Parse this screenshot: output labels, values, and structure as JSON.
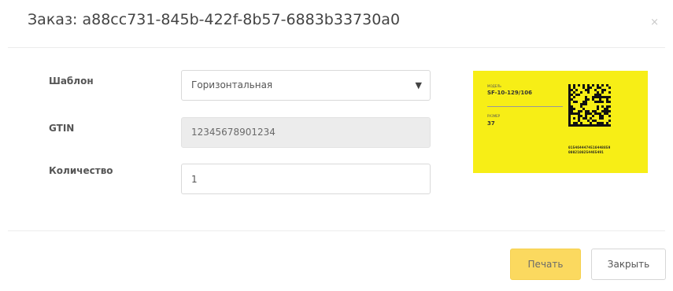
{
  "modal": {
    "title": "Заказ: a88cc731-845b-422f-8b57-6883b33730a0",
    "close_icon": "×"
  },
  "form": {
    "template": {
      "label": "Шаблон",
      "selected": "Горизонтальная",
      "arrow_icon": "▼"
    },
    "gtin": {
      "label": "GTIN",
      "value": "12345678901234"
    },
    "quantity": {
      "label": "Количество",
      "value": "1"
    }
  },
  "preview": {
    "background": "#f7ee16",
    "model_caption": "МОДЕЛЬ",
    "model": "SF-10-129/106",
    "size_caption": "РАЗМЕР",
    "size": "37",
    "code_line1": "0154644474516448859",
    "code_line2": "0002100254465491"
  },
  "footer": {
    "print_label": "Печать",
    "close_label": "Закрыть"
  },
  "colors": {
    "accent": "#fbd95f",
    "label_yellow": "#f7ee16"
  }
}
